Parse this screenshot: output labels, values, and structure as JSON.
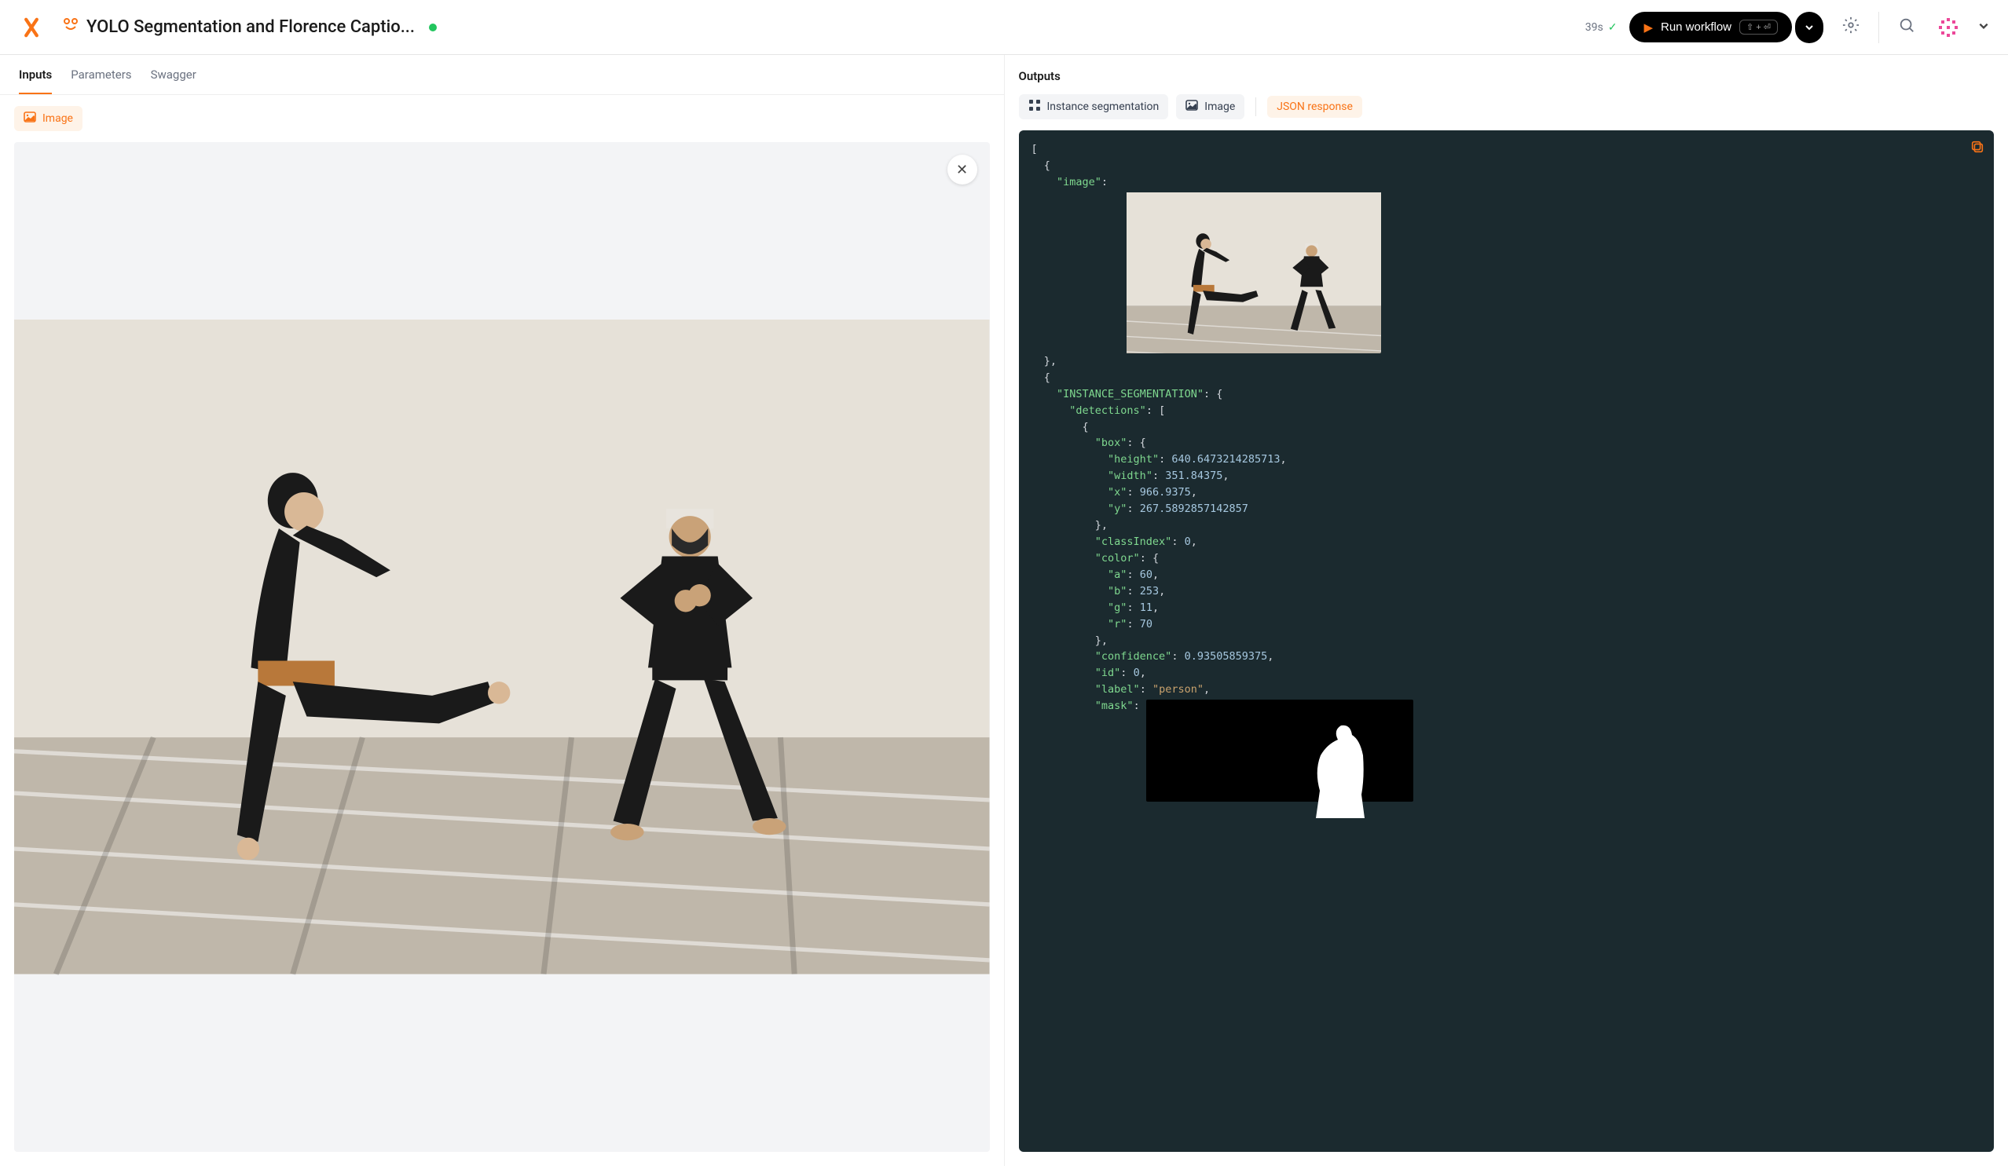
{
  "header": {
    "title": "YOLO Segmentation and Florence Captio...",
    "elapsed": "39s",
    "run_label": "Run workflow",
    "kbd_hint": "⇧ + ⏎"
  },
  "left": {
    "tabs": [
      "Inputs",
      "Parameters",
      "Swagger"
    ],
    "active_tab": 0,
    "image_chip": "Image"
  },
  "right": {
    "title": "Outputs",
    "chips": {
      "instance_seg": "Instance segmentation",
      "image": "Image",
      "json": "JSON response"
    }
  },
  "json": {
    "image_key": "\"image\"",
    "inst_seg_key": "\"INSTANCE_SEGMENTATION\"",
    "detections_key": "\"detections\"",
    "box_key": "\"box\"",
    "height_key": "\"height\"",
    "height_val": "640.6473214285713",
    "width_key": "\"width\"",
    "width_val": "351.84375",
    "x_key": "\"x\"",
    "x_val": "966.9375",
    "y_key": "\"y\"",
    "y_val": "267.5892857142857",
    "classIndex_key": "\"classIndex\"",
    "classIndex_val": "0",
    "color_key": "\"color\"",
    "a_key": "\"a\"",
    "a_val": "60",
    "b_key": "\"b\"",
    "b_val": "253",
    "g_key": "\"g\"",
    "g_val": "11",
    "r_key": "\"r\"",
    "r_val": "70",
    "confidence_key": "\"confidence\"",
    "confidence_val": "0.93505859375",
    "id_key": "\"id\"",
    "id_val": "0",
    "label_key": "\"label\"",
    "label_val": "\"person\"",
    "mask_key": "\"mask\""
  }
}
